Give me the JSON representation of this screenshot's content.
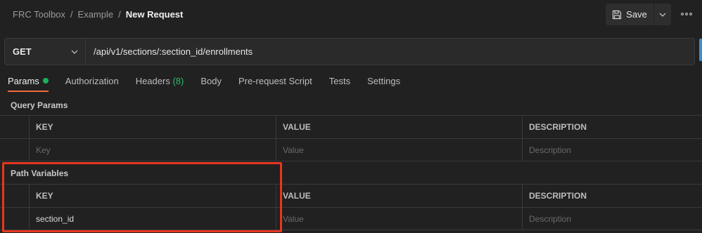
{
  "breadcrumb": {
    "items": [
      "FRC Toolbox",
      "Example"
    ],
    "separator": "/",
    "current": "New Request"
  },
  "toolbar": {
    "save_label": "Save",
    "save_icon": "floppy-disk-icon",
    "dropdown_icon": "chevron-down-icon",
    "more_icon": "more-horizontal-icon"
  },
  "request": {
    "method": "GET",
    "url": "/api/v1/sections/:section_id/enrollments"
  },
  "tabs": [
    {
      "label": "Params",
      "active": true,
      "indicator": "green-dot"
    },
    {
      "label": "Authorization"
    },
    {
      "label": "Headers",
      "count": "(8)"
    },
    {
      "label": "Body"
    },
    {
      "label": "Pre-request Script"
    },
    {
      "label": "Tests"
    },
    {
      "label": "Settings"
    }
  ],
  "query_params": {
    "title": "Query Params",
    "headers": {
      "key": "KEY",
      "value": "VALUE",
      "description": "DESCRIPTION"
    },
    "placeholders": {
      "key": "Key",
      "value": "Value",
      "description": "Description"
    }
  },
  "path_variables": {
    "title": "Path Variables",
    "headers": {
      "key": "KEY",
      "value": "VALUE",
      "description": "DESCRIPTION"
    },
    "rows": [
      {
        "key": "section_id",
        "value_placeholder": "Value",
        "description_placeholder": "Description"
      }
    ]
  },
  "colors": {
    "background": "#212121",
    "accent": "#f26b3a",
    "status_green": "#19b35a",
    "highlight": "#e8351f"
  }
}
